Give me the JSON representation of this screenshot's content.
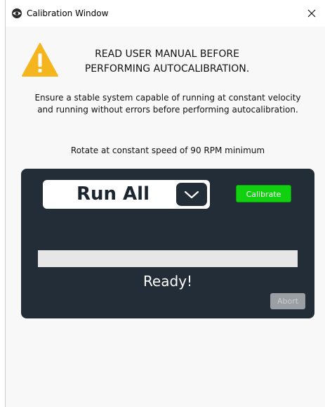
{
  "window": {
    "title": "Calibration Window",
    "app_icon": "eye-logo-icon",
    "close_glyph": "✕"
  },
  "warning": {
    "icon": "warning-triangle-icon",
    "line1": "READ USER MANUAL BEFORE",
    "line2": "PERFORMING AUTOCALIBRATION."
  },
  "info": {
    "line1": "Ensure a stable system capable of running at constant velocity",
    "line2": "and running without errors before performing autocalibration."
  },
  "rpm_note": "Rotate at constant speed of 90 RPM minimum",
  "panel": {
    "mode": {
      "selected": "Run All",
      "chevron_icon": "chevron-down-icon"
    },
    "calibrate_label": "Calibrate",
    "progress": 0,
    "status": "Ready!",
    "abort_label": "Abort",
    "colors": {
      "panel_bg": "#222d38",
      "calibrate_bg": "#10d010",
      "abort_bg": "#9a9fa4",
      "warning": "#f5b51e"
    }
  }
}
